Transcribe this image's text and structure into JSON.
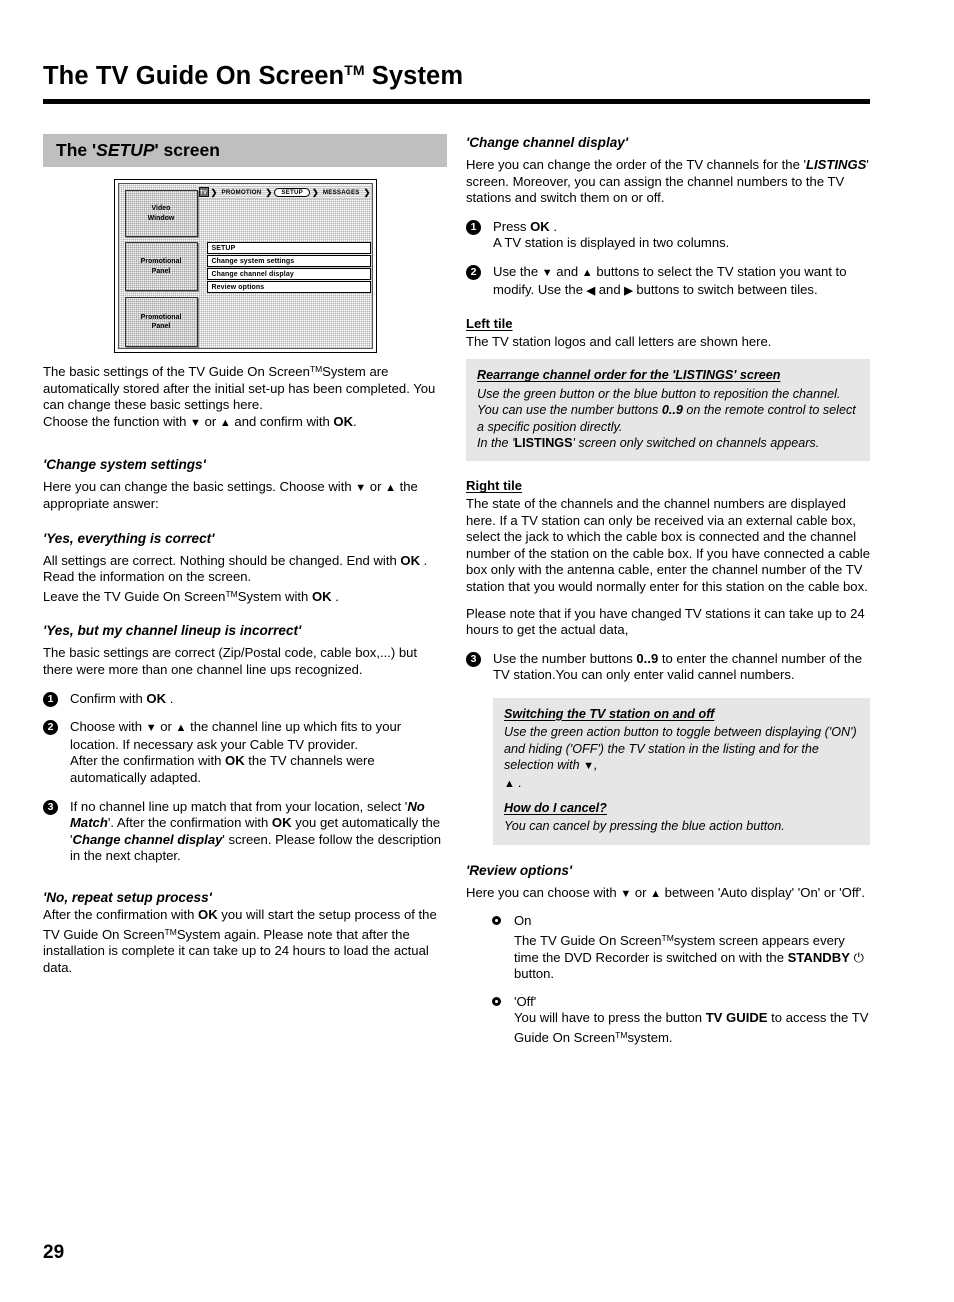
{
  "header": {
    "title_main": "The TV Guide On Screen",
    "title_tm": "TM",
    "title_tail": "System"
  },
  "left_column": {
    "section_banner": {
      "pre": "The '",
      "emph": "SETUP",
      "post": "' screen"
    },
    "tv_mockup": {
      "nav": {
        "logo_label": "TV",
        "items": [
          "PROMOTION",
          "SETUP",
          "MESSAGES"
        ],
        "active_item": "SETUP",
        "separator": "❯"
      },
      "tiles": [
        "Video\nWindow",
        "Promotional\nPanel",
        "Promotional\nPanel"
      ],
      "menu_rows": [
        "SETUP",
        "Change system settings",
        "Change channel display",
        "Review options"
      ]
    },
    "intro": {
      "p1_a": "The basic settings of the TV Guide On Screen",
      "p1_tm": "TM",
      "p1_b": "System are automatically stored after the initial set-up has been completed. You can change these basic settings here.",
      "p2_a": "Choose the function with",
      "p2_down": "▼",
      "p2_or": "or",
      "p2_up": "▲",
      "p2_b": "and confirm with",
      "p2_ok": "OK",
      "p2_dot": "."
    },
    "change_system_settings": {
      "heading": "'Change system settings'",
      "intro_a": "Here you can change the basic settings. Choose with",
      "down": "▼",
      "or": "or",
      "up": "▲",
      "intro_b": "the appropriate answer:"
    },
    "yes_everything": {
      "heading": "'Yes, everything is correct'",
      "l1_a": "All settings are correct. Nothing should be changed. End with",
      "l1_ok": "OK",
      "l1_b": ".",
      "l2": "Read the information on the screen.",
      "l3_a": "Leave the TV Guide On Screen",
      "l3_tm": "TM",
      "l3_b": "System with",
      "l3_ok": "OK",
      "l3_c": "."
    },
    "yes_but": {
      "heading": "'Yes, but my channel lineup is incorrect'",
      "intro": "The basic settings are correct (Zip/Postal code, cable box,...) but there were more than one channel line ups recognized.",
      "steps": [
        {
          "num": "1",
          "a": "Confirm with",
          "ok": "OK",
          "b": "."
        },
        {
          "num": "2",
          "a": "Choose with",
          "down": "▼",
          "or": "or",
          "up": "▲",
          "b": "the channel line up which fits to your location. If necessary ask your Cable TV provider.",
          "c": "After the confirmation with",
          "ok": "OK",
          "d": "the TV channels were automatically adapted."
        },
        {
          "num": "3",
          "a": "If no channel line up match that from your location, select '",
          "em1": "No Match",
          "b": "'. After the confirmation with",
          "ok": "OK",
          "c": "you get automatically the '",
          "em2": "Change channel display",
          "d": "' screen. Please follow the description in the next chapter."
        }
      ]
    },
    "no_repeat": {
      "heading": "'No, repeat setup process'",
      "a": "After the confirmation with",
      "ok": "OK",
      "b": "you will start the setup process of the TV Guide On Screen",
      "tm": "TM",
      "c": "System again. Please note that after the installation is complete it can take up to 24 hours to load the actual data."
    }
  },
  "right_column": {
    "change_channel_display": {
      "heading": "'Change channel display'",
      "intro_a": "Here you can change the order of the TV channels for the '",
      "intro_em": "LISTINGS",
      "intro_b": "' screen. Moreover, you can assign the channel numbers to the TV stations and switch them on or off.",
      "steps": [
        {
          "num": "1",
          "a": "Press",
          "ok": "OK",
          "b": ".",
          "c": "A TV station is displayed in two columns."
        },
        {
          "num": "2",
          "a": "Use the",
          "down": "▼",
          "and": "and",
          "up": "▲",
          "b": "buttons to select the TV station you want to modify. Use the",
          "left": "◀",
          "and2": "and",
          "right": "▶",
          "c": "buttons to switch between tiles."
        }
      ]
    },
    "left_tile": {
      "heading": "Left tile",
      "text": "The TV station logos and call letters are shown here.",
      "note": {
        "heading_a": "Rearrange channel order for the '",
        "heading_em": "LISTINGS",
        "heading_b": "' screen",
        "l1": "Use the green button or the blue button to reposition the channel.",
        "l2_a": "You can use the number buttons",
        "l2_num": "0..9",
        "l2_b": "on the remote control to select a specific position directly.",
        "l3_a": "In the '",
        "l3_em": "LISTINGS",
        "l3_b": "' screen only switched on channels appears."
      }
    },
    "right_tile": {
      "heading": "Right tile",
      "text": "The state of the channels and the channel numbers are displayed here. If a TV station can only be received via an external cable box, select the jack to which the cable box is connected and the channel number of the station on the cable box. If you have connected a cable box only with the antenna cable, enter the channel number of the TV station that you would normally enter for this station on the cable box.",
      "note_text": "Please note that if you have changed TV stations it can take up to 24 hours to get the actual data,",
      "step3": {
        "num": "3",
        "a": "Use the number buttons",
        "num_range": "0..9",
        "b": "to enter the channel number of the TV station.You can only enter valid cannel numbers."
      },
      "note": {
        "heading1": "Switching the TV station on and off",
        "body1_a": "Use the green action button to toggle between displaying ('ON') and hiding ('OFF') the TV station in the listing and for the selection with",
        "body1_down": "▼",
        "body1_comma": ",",
        "body1_up": "▲",
        "body1_dot": ".",
        "heading2": "How do I cancel?",
        "body2": "You can cancel by pressing the blue action button."
      }
    },
    "review_options": {
      "heading": "'Review options'",
      "intro_a": "Here you can choose with",
      "down": "▼",
      "or": "or",
      "up": "▲",
      "intro_b": "between 'Auto display' 'On' or 'Off'.",
      "bullets": [
        {
          "label": "On",
          "body_a": "The TV Guide On Screen",
          "body_tm": "TM",
          "body_b": "system screen appears every time the DVD Recorder is switched on with the",
          "standby": "STANDBY",
          "power": "⏻",
          "body_c": "button."
        },
        {
          "label": "'Off'",
          "body_a": "You will have to press the button",
          "tvguide": "TV GUIDE",
          "body_b": "to access the TV Guide On Screen",
          "body_tm": "TM",
          "body_c": "system."
        }
      ]
    }
  },
  "footer": {
    "page_number": "29"
  }
}
